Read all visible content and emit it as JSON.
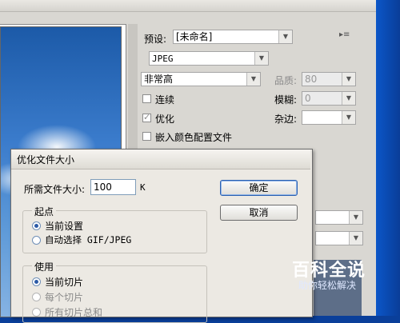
{
  "settings": {
    "preset_label": "预设:",
    "preset_value": "[未命名]",
    "format_value": "JPEG",
    "quality_mode_value": "非常高",
    "quality_label": "品质:",
    "quality_value": "80",
    "progressive_label": "连续",
    "blur_label": "模糊:",
    "blur_value": "0",
    "optimized_label": "优化",
    "matte_label": "杂边:",
    "embed_profile_label": "嵌入颜色配置文件"
  },
  "dialog": {
    "title": "优化文件大小",
    "desired_size_label": "所需文件大小:",
    "desired_size_value": "100",
    "size_unit": "K",
    "ok_label": "确定",
    "cancel_label": "取消",
    "start_group": {
      "title": "起点",
      "options": [
        "当前设置",
        "自动选择 GIF/JPEG"
      ],
      "selected": 0
    },
    "use_group": {
      "title": "使用",
      "options": [
        "当前切片",
        "每个切片",
        "所有切片总和"
      ],
      "selected": 0
    }
  },
  "watermark": {
    "title": "百科全说",
    "subtitle": "助你轻松解决"
  }
}
